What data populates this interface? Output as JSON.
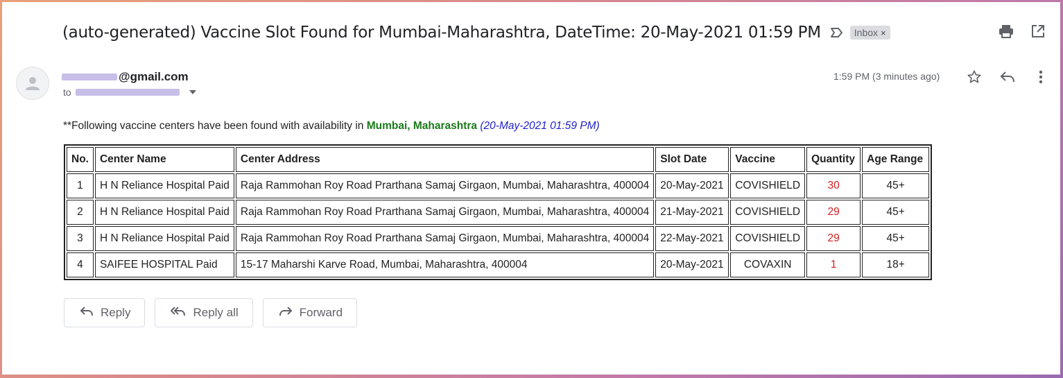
{
  "email": {
    "subject": "(auto-generated) Vaccine Slot Found for Mumbai-Maharashtra, DateTime: 20-May-2021 01:59 PM",
    "label": "Inbox",
    "label_remove": "×",
    "sender_domain": "@gmail.com",
    "to_prefix": "to",
    "time": "1:59 PM (3 minutes ago)"
  },
  "body": {
    "intro_text": "**Following vaccine centers have been found with availability in ",
    "location": "Mumbai, Maharashtra",
    "datetime": "(20-May-2021 01:59 PM)"
  },
  "table": {
    "headers": [
      "No.",
      "Center Name",
      "Center Address",
      "Slot Date",
      "Vaccine",
      "Quantity",
      "Age Range"
    ],
    "rows": [
      [
        "1",
        "H N Reliance Hospital Paid",
        "Raja Rammohan Roy Road Prarthana Samaj Girgaon, Mumbai, Maharashtra, 400004",
        "20-May-2021",
        "COVISHIELD",
        "30",
        "45+"
      ],
      [
        "2",
        "H N Reliance Hospital Paid",
        "Raja Rammohan Roy Road Prarthana Samaj Girgaon, Mumbai, Maharashtra, 400004",
        "21-May-2021",
        "COVISHIELD",
        "29",
        "45+"
      ],
      [
        "3",
        "H N Reliance Hospital Paid",
        "Raja Rammohan Roy Road Prarthana Samaj Girgaon, Mumbai, Maharashtra, 400004",
        "22-May-2021",
        "COVISHIELD",
        "29",
        "45+"
      ],
      [
        "4",
        "SAIFEE HOSPITAL Paid",
        "15-17 Maharshi Karve Road, Mumbai, Maharashtra, 400004",
        "20-May-2021",
        "COVAXIN",
        "1",
        "18+"
      ]
    ]
  },
  "actions": {
    "reply": "Reply",
    "reply_all": "Reply all",
    "forward": "Forward"
  },
  "icons": {
    "important": "important-marker-icon",
    "print": "print-icon",
    "open_new_window": "open-in-new-window-icon",
    "star": "star-icon",
    "reply": "reply-icon",
    "more": "more-vertical-icon",
    "avatar": "default-avatar-icon"
  },
  "colors": {
    "location": "#1a7a1a",
    "datetime": "#1f1fcc",
    "quantity": "#d42020"
  }
}
